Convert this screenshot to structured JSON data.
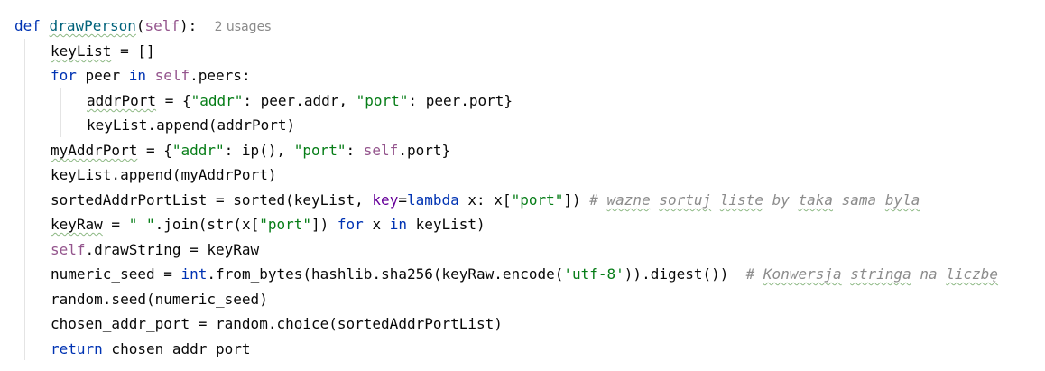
{
  "code": {
    "def_kw": "def",
    "fn_name": "drawPerson",
    "fn_open": "(",
    "fn_self": "self",
    "fn_close": "):",
    "usage_hint": "2 usages",
    "line2": {
      "var": "keyList",
      "rest": " = []"
    },
    "line3": {
      "for_kw": "for",
      "a": " peer ",
      "in_kw": "in",
      "b": " ",
      "self": "self",
      "c": ".peers:"
    },
    "line4": {
      "var": "addrPort",
      "a": " = {",
      "s1": "\"addr\"",
      "b": ": peer.addr, ",
      "s2": "\"port\"",
      "c": ": peer.port}"
    },
    "line5": {
      "text": "keyList.append(addrPort)"
    },
    "line6": {
      "var": "myAddrPort",
      "a": " = {",
      "s1": "\"addr\"",
      "b": ": ip(), ",
      "s2": "\"port\"",
      "c": ": ",
      "self": "self",
      "d": ".port}"
    },
    "line7": {
      "text": "keyList.append(myAddrPort)"
    },
    "line8": {
      "a": "sortedAddrPortList = sorted(keyList, ",
      "param": "key",
      "b": "=",
      "lambda_kw": "lambda",
      "c": " x: x[",
      "s1": "\"port\"",
      "d": "]) ",
      "comment_hash": "# ",
      "w1": "wazne",
      "sp1": " ",
      "w2": "sortuj",
      "sp2": " ",
      "w3": "liste",
      "w4": " by ",
      "w5": "taka",
      "w6": " sama ",
      "w7": "byla"
    },
    "line9": {
      "var": "keyRaw",
      "a": " = ",
      "s1": "\" \"",
      "b": ".join(str(x[",
      "s2": "\"port\"",
      "c": "]) ",
      "for_kw": "for",
      "d": " x ",
      "in_kw": "in",
      "e": " keyList)"
    },
    "line10": {
      "self": "self",
      "a": ".drawString = keyRaw"
    },
    "line11": {
      "a": "numeric_seed = ",
      "int_kw": "int",
      "b": ".from_bytes(hashlib.sha256(keyRaw.encode(",
      "s1": "'utf-8'",
      "c": ")).digest())  ",
      "comment_hash": "# ",
      "w1": "Konwersja",
      "sp1": " ",
      "w2": "stringa",
      "w3": " na ",
      "w4": "liczbę"
    },
    "line12": {
      "text": "random.seed(numeric_seed)"
    },
    "line13": {
      "text": "chosen_addr_port = random.choice(sortedAddrPortList)"
    },
    "line14": {
      "return_kw": "return",
      "a": " chosen_addr_port"
    }
  }
}
